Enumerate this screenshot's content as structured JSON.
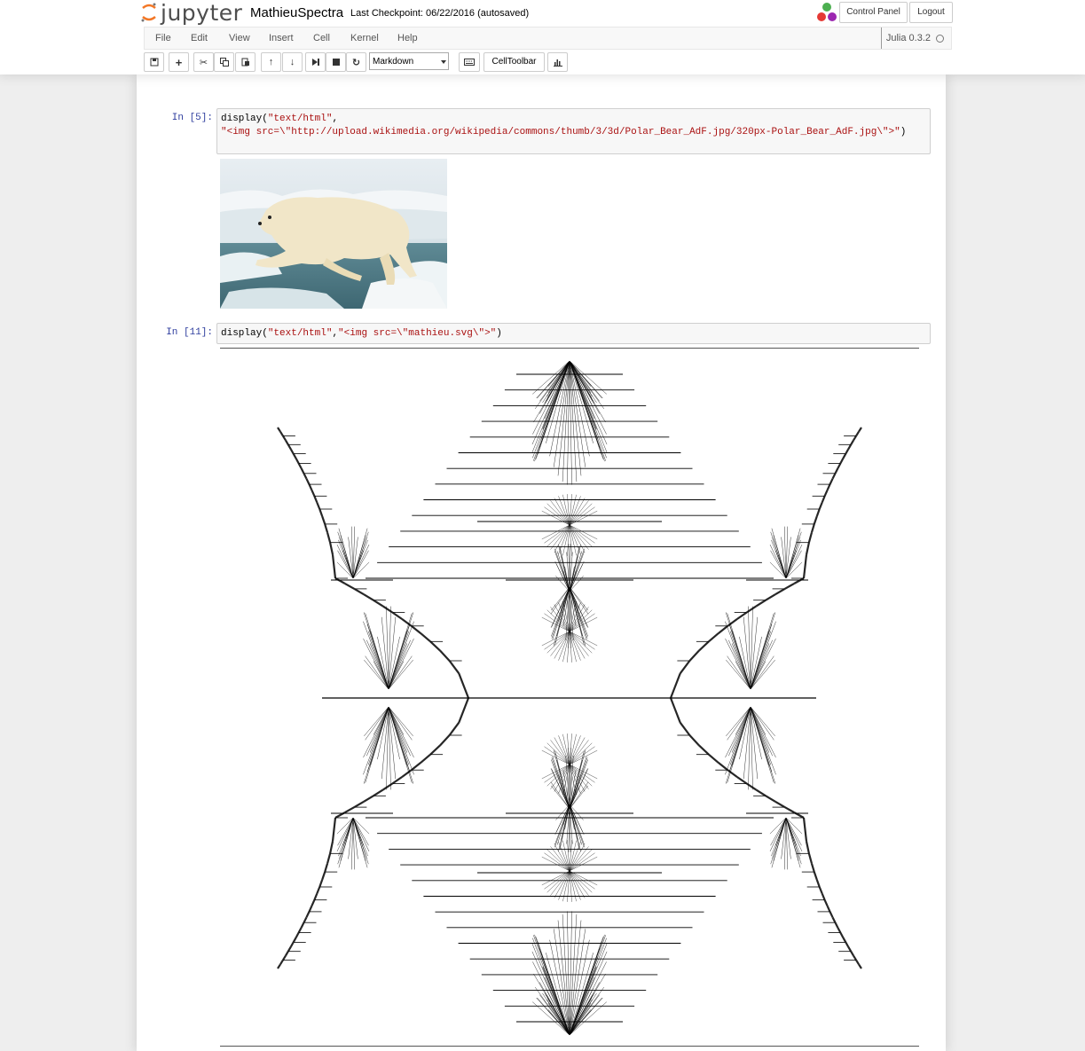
{
  "header": {
    "logo_text": "jupyter",
    "notebook_name": "MathieuSpectra",
    "checkpoint": "Last Checkpoint: 06/22/2016 (autosaved)",
    "control_panel": "Control Panel",
    "logout": "Logout"
  },
  "menubar": {
    "items": [
      "File",
      "Edit",
      "View",
      "Insert",
      "Cell",
      "Kernel",
      "Help"
    ],
    "kernel_name": "Julia 0.3.2"
  },
  "toolbar": {
    "cell_type": "Markdown",
    "celltoolbar": "CellToolbar"
  },
  "cells": [
    {
      "prompt": "In [5]:",
      "code_fn": "display(",
      "code_arg1": "\"text/html\"",
      "code_sep": ",",
      "code_line2": "\"<img src=\\\"http://upload.wikimedia.org/wikipedia/commons/thumb/3/3d/Polar_Bear_AdF.jpg/320px-Polar_Bear_AdF.jpg\\\">\"",
      "code_close": ")"
    },
    {
      "prompt": "In [11]:",
      "code_fn": "display(",
      "code_arg1": "\"text/html\"",
      "code_sep": ",",
      "code_arg2": "\"<img src=\\\"mathieu.svg\\\">\"",
      "code_close": ")"
    }
  ],
  "colors": {
    "prompt_in": "#303f9f",
    "string": "#aa1111",
    "kernel_logo": [
      "#4caf50",
      "#e53935",
      "#9c27b0"
    ]
  }
}
